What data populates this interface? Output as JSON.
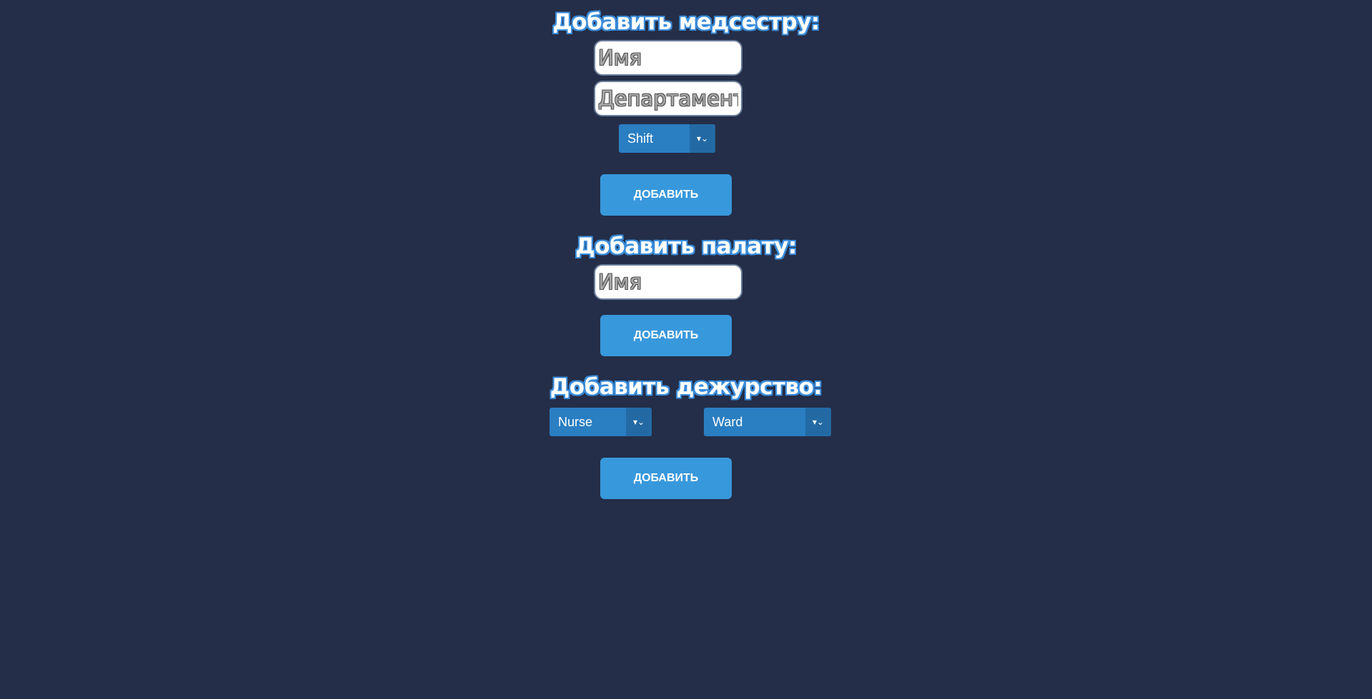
{
  "nurse_section": {
    "title": "Добавить медсестру:",
    "name_placeholder": "Имя",
    "department_placeholder": "Департамент",
    "shift_select": "Shift",
    "add_button": "ДОБАВИТЬ"
  },
  "ward_section": {
    "title": "Добавить палату:",
    "name_placeholder": "Имя",
    "add_button": "ДОБАВИТЬ"
  },
  "duty_section": {
    "title": "Добавить дежурство:",
    "nurse_select": "Nurse",
    "ward_select": "Ward",
    "add_button": "ДОБАВИТЬ"
  },
  "colors": {
    "background": "#242e48",
    "button": "#3898dc",
    "select": "#2a7ec2",
    "heading_outline": "#3a8ddb"
  }
}
